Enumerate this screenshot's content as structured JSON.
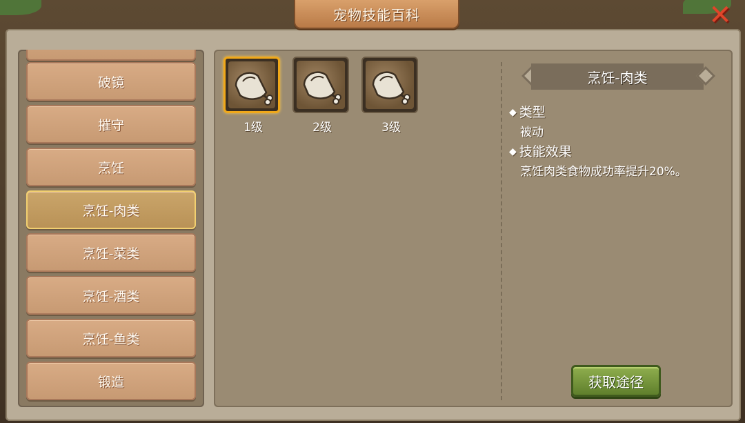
{
  "title": "宠物技能百科",
  "close_icon": "close-icon",
  "skill_list": [
    {
      "label": "破镜"
    },
    {
      "label": "摧守"
    },
    {
      "label": "烹饪"
    },
    {
      "label": "烹饪-肉类",
      "active": true
    },
    {
      "label": "烹饪-菜类"
    },
    {
      "label": "烹饪-酒类"
    },
    {
      "label": "烹饪-鱼类"
    },
    {
      "label": "锻造"
    }
  ],
  "levels": [
    {
      "label": "1级",
      "selected": true,
      "icon": "meat-drumstick-icon"
    },
    {
      "label": "2级",
      "selected": false,
      "icon": "meat-drumstick-icon"
    },
    {
      "label": "3级",
      "selected": false,
      "icon": "meat-drumstick-icon"
    }
  ],
  "detail": {
    "name": "烹饪-肉类",
    "type_label": "类型",
    "type_value": "被动",
    "effect_label": "技能效果",
    "effect_value": "烹饪肉类食物成功率提升20%。"
  },
  "obtain_button": "获取途径",
  "colors": {
    "selected_border": "#f0a81a",
    "active_item_border": "#f2d070",
    "obtain_button": "#6f8f35",
    "close": "#e0452a"
  }
}
